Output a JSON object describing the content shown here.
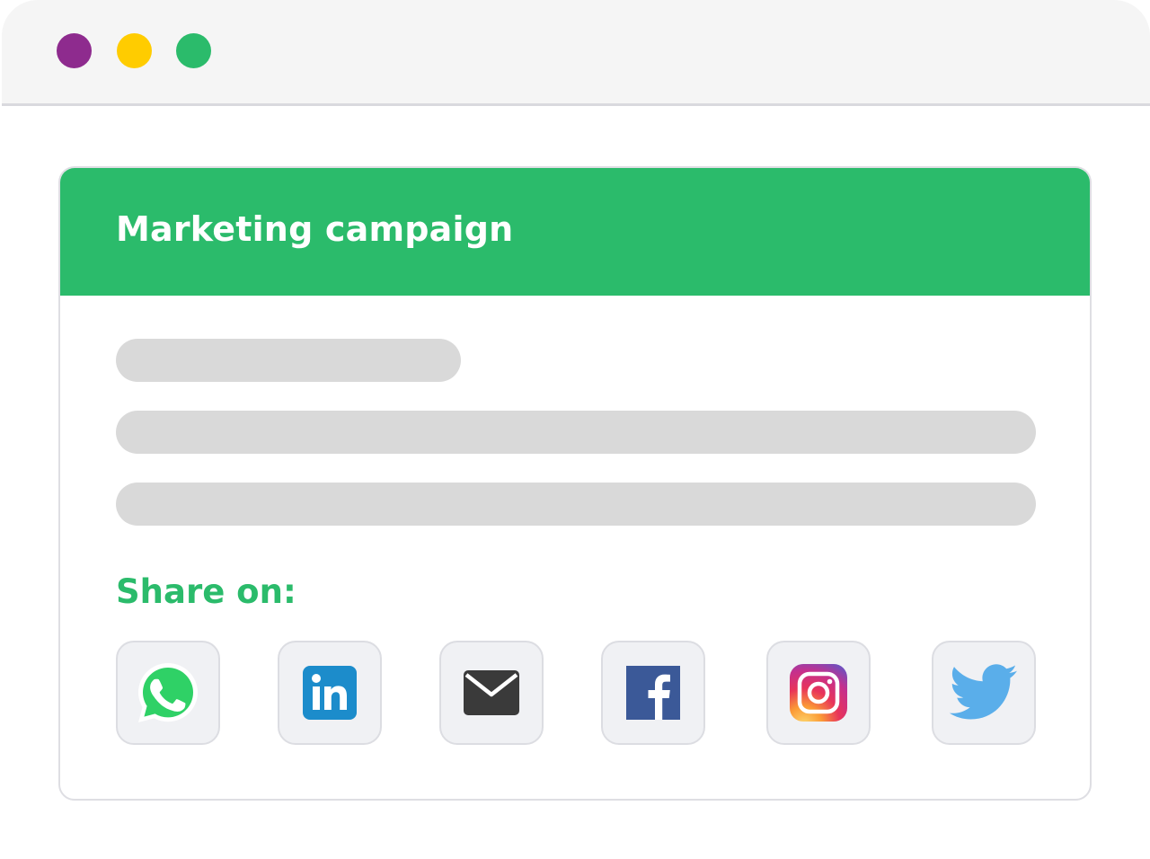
{
  "window": {
    "controls": {
      "close_color": "#8e2b8e",
      "minimize_color": "#ffcc00",
      "maximize_color": "#2bbb6b"
    }
  },
  "card": {
    "title": "Marketing campaign",
    "header_color": "#2bbb6b",
    "share_label": "Share on:",
    "share_label_color": "#2bbb6b",
    "share_options": [
      {
        "name": "whatsapp",
        "icon": "whatsapp-icon"
      },
      {
        "name": "linkedin",
        "icon": "linkedin-icon"
      },
      {
        "name": "email",
        "icon": "mail-icon"
      },
      {
        "name": "facebook",
        "icon": "facebook-icon"
      },
      {
        "name": "instagram",
        "icon": "instagram-icon"
      },
      {
        "name": "twitter",
        "icon": "twitter-icon"
      }
    ]
  }
}
